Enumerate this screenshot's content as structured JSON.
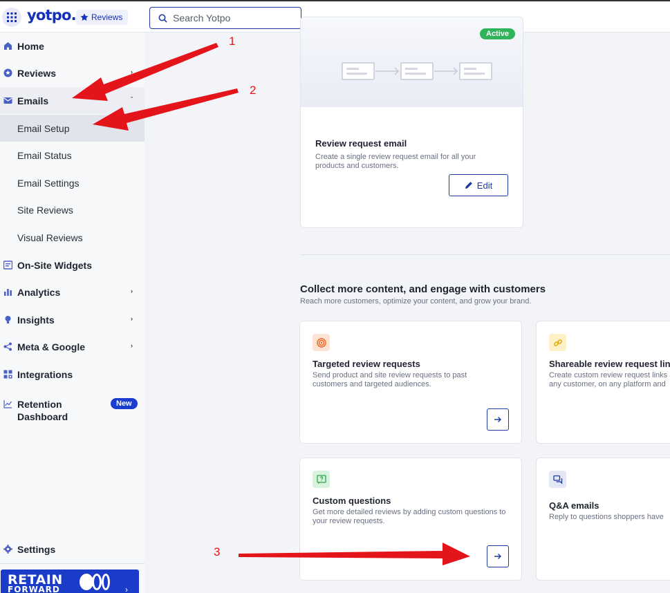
{
  "topbar": {
    "logo": "yotpo.",
    "product_badge": "Reviews",
    "search_placeholder": "Search Yotpo"
  },
  "sidebar": {
    "items": [
      {
        "label": "Home",
        "icon": "home-icon"
      },
      {
        "label": "Reviews",
        "icon": "star-icon"
      },
      {
        "label": "Emails",
        "icon": "mail-icon"
      },
      {
        "label": "Email Setup"
      },
      {
        "label": "Email Status"
      },
      {
        "label": "Email Settings"
      },
      {
        "label": "Site Reviews"
      },
      {
        "label": "Visual Reviews"
      },
      {
        "label": "On-Site Widgets",
        "icon": "widget-icon"
      },
      {
        "label": "Analytics",
        "icon": "bar-chart-icon"
      },
      {
        "label": "Insights",
        "icon": "lightbulb-icon"
      },
      {
        "label": "Meta & Google",
        "icon": "share-icon"
      },
      {
        "label": "Integrations",
        "icon": "apps-icon"
      },
      {
        "label": "Retention Dashboard",
        "icon": "trend-icon",
        "badge": "New"
      }
    ],
    "settings_label": "Settings",
    "banner": {
      "line1": "RETAIN",
      "line2": "FORWARD"
    }
  },
  "main": {
    "review_card": {
      "status": "Active",
      "title": "Review request email",
      "description": "Create a single review request email for all your products and customers.",
      "edit_label": "Edit"
    },
    "section": {
      "title": "Collect more content, and engage with customers",
      "subtitle": "Reach more customers, optimize your content, and grow your brand."
    },
    "features": [
      {
        "title": "Targeted review requests",
        "description": "Send product and site review requests to past customers and targeted audiences.",
        "icon": "target-icon",
        "color": "#f4621f"
      },
      {
        "title": "Shareable review request links",
        "description": "Create custom review request links and share with any customer, on any platform and",
        "icon": "link-icon",
        "color": "#e0a800"
      },
      {
        "title": "Custom questions",
        "description": "Get more detailed reviews by adding custom questions to your review requests.",
        "icon": "question-icon",
        "color": "#27a34a"
      },
      {
        "title": "Q&A emails",
        "description": "Reply to questions shoppers have",
        "icon": "chat-icon",
        "color": "#1d3a9e"
      }
    ]
  },
  "annotations": [
    "1",
    "2",
    "3"
  ],
  "colors": {
    "accent": "#1d3a9e",
    "annotation": "#e4141b",
    "active": "#2fb45a"
  }
}
